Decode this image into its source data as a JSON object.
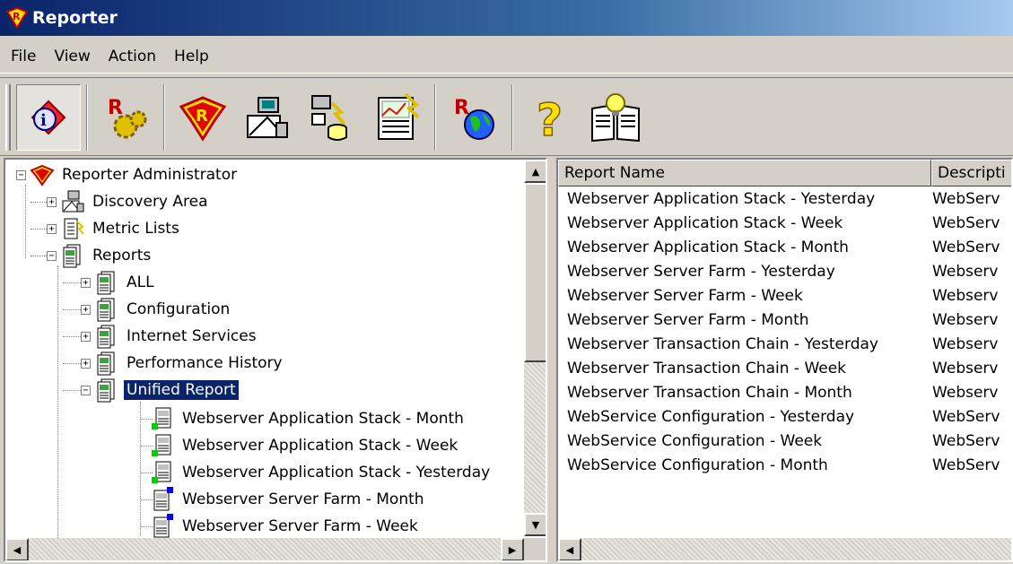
{
  "window": {
    "title": "Reporter"
  },
  "menu": [
    "File",
    "View",
    "Action",
    "Help"
  ],
  "toolbar": {
    "buttons": [
      {
        "icon": "info-icon",
        "pressed": true
      },
      {
        "icon": "reporter-settings-icon"
      },
      {
        "icon": "reporter-logo-icon"
      },
      {
        "icon": "discovery-icon"
      },
      {
        "icon": "database-metric-icon"
      },
      {
        "icon": "report-chart-icon"
      },
      {
        "icon": "reporter-web-icon"
      },
      {
        "icon": "help-icon"
      },
      {
        "icon": "manual-book-icon"
      }
    ]
  },
  "tree": {
    "root": "Reporter Administrator",
    "discovery": "Discovery Area",
    "metric_lists": "Metric Lists",
    "reports": "Reports",
    "folders": [
      "ALL",
      "Configuration",
      "Internet Services",
      "Performance History",
      "Unified Report"
    ],
    "unified_items": [
      "Webserver Application Stack - Month",
      "Webserver Application Stack - Week",
      "Webserver Application Stack - Yesterday",
      "Webserver Server Farm - Month",
      "Webserver Server Farm - Week"
    ]
  },
  "list": {
    "columns": [
      "Report Name",
      "Descripti"
    ],
    "rows": [
      [
        "Webserver Application Stack - Yesterday",
        "WebServ"
      ],
      [
        "Webserver Application Stack - Week",
        "WebServ"
      ],
      [
        "Webserver Application Stack - Month",
        "WebServ"
      ],
      [
        "Webserver Server Farm - Yesterday",
        "Webserv"
      ],
      [
        "Webserver Server Farm - Week",
        "Webserv"
      ],
      [
        "Webserver Server Farm - Month",
        "Webserv"
      ],
      [
        "Webserver Transaction Chain - Yesterday",
        "Webserv"
      ],
      [
        "Webserver Transaction Chain - Week",
        "Webserv"
      ],
      [
        "Webserver Transaction Chain - Month",
        "Webserv"
      ],
      [
        "WebService Configuration - Yesterday",
        "WebServ"
      ],
      [
        "WebService Configuration - Week",
        "WebServ"
      ],
      [
        "WebService Configuration - Month",
        "WebServ"
      ]
    ]
  },
  "colors": {
    "title_start": "#0a246a",
    "title_end": "#a6caf0",
    "selection": "#0a246a",
    "face": "#d4d0c8"
  }
}
